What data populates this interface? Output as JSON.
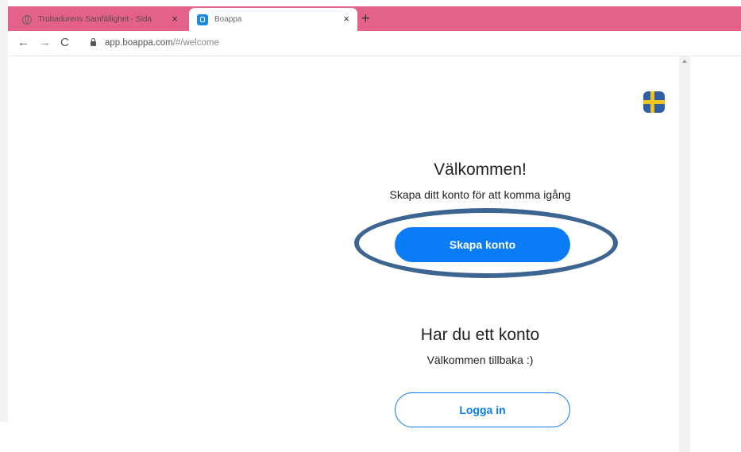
{
  "browser": {
    "tabs": [
      {
        "label": "Trubadurens Samfällighet - Sida",
        "close": "×",
        "icon": "globe-icon"
      },
      {
        "label": "Boappa",
        "close": "×",
        "icon": "boappa-icon"
      }
    ],
    "new_tab": "+",
    "nav": {
      "back": "←",
      "forward": "→",
      "reload": "C"
    },
    "address": {
      "host": "app.boappa.com",
      "path": "/#/welcome"
    }
  },
  "page": {
    "language_flag": "sweden-flag-icon",
    "welcome_title": "Välkommen!",
    "welcome_sub": "Skapa ditt konto för att komma igång",
    "create_button": "Skapa konto",
    "existing_title": "Har du ett konto",
    "existing_sub": "Välkommen tillbaka :)",
    "login_button": "Logga in"
  },
  "colors": {
    "tabstrip": "#e4628a",
    "primary": "#0a7cf5",
    "highlight": "#3d6591",
    "flag_blue": "#2e5fa6",
    "flag_yellow": "#f0c419"
  }
}
